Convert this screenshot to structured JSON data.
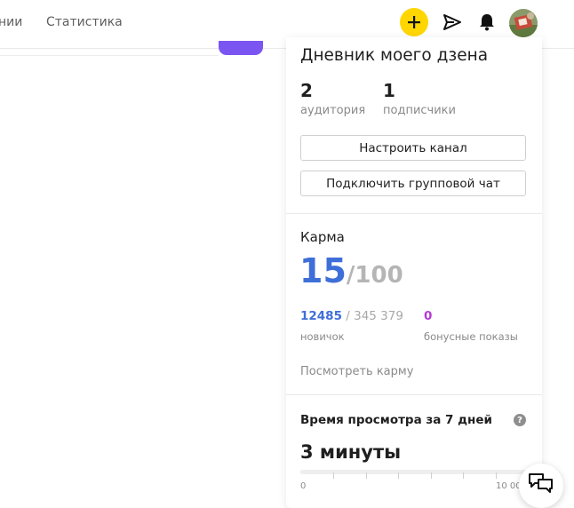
{
  "header": {
    "nav_partial": "нии",
    "nav_statistics": "Статистика"
  },
  "channel": {
    "title": "Дневник моего дзена",
    "audience_value": "2",
    "audience_label": "аудитория",
    "subscribers_value": "1",
    "subscribers_label": "подписчики",
    "settings_button": "Настроить канал",
    "group_chat_button": "Подключить групповой чат"
  },
  "karma": {
    "title": "Карма",
    "score": "15",
    "max": "/100",
    "progress_current": "12485",
    "progress_total": " / 345 379",
    "level_label": "новичок",
    "bonus_value": "0",
    "bonus_label": "бонусные показы",
    "view_link": "Посмотреть карму"
  },
  "watch_time": {
    "title": "Время просмотра за 7 дней",
    "help": "?",
    "value": "3 минуты",
    "axis_min": "0",
    "axis_max": "10 00"
  },
  "colors": {
    "accent_yellow": "#ffd600",
    "karma_blue": "#3e6fd8",
    "bonus_purple": "#b43ad6",
    "search_purple": "#7b55f2"
  },
  "icons": {
    "add": "plus-icon",
    "publish": "send-icon",
    "notifications": "bell-icon",
    "profile": "avatar",
    "support": "chat-icon"
  }
}
